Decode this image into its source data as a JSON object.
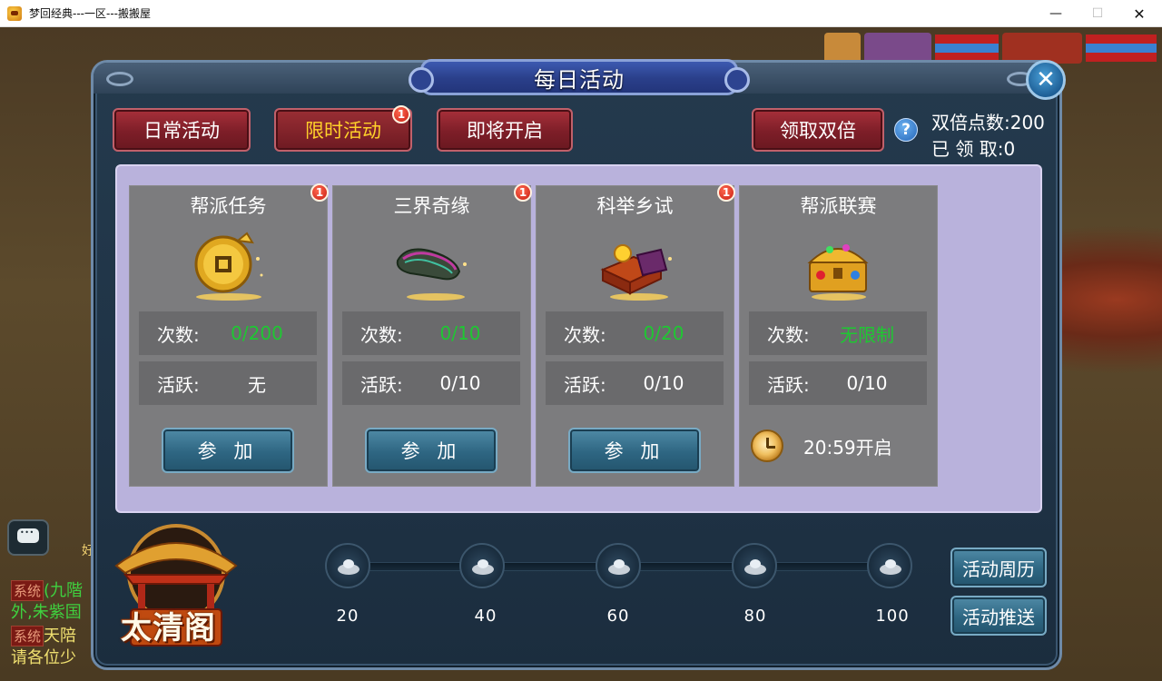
{
  "window": {
    "title": "梦回经典---一区---搬搬屋",
    "minimize": "—",
    "maximize": "☐",
    "close": "✕"
  },
  "chat": {
    "lines": [
      {
        "tag": "系统",
        "text": "(九階"
      },
      {
        "text": "外,朱紫国"
      },
      {
        "tag": "系统",
        "text": "天陪"
      },
      {
        "text": "请各位少"
      }
    ],
    "hud_partial": "好"
  },
  "dialog": {
    "title": "每日活动",
    "close_glyph": "✕",
    "tabs": [
      {
        "label": "日常活动",
        "active": false
      },
      {
        "label": "限时活动",
        "active": true,
        "badge": "1"
      },
      {
        "label": "即将开启",
        "active": false
      }
    ],
    "double_button": "领取双倍",
    "help_glyph": "?",
    "double_points": "双倍点数:200",
    "claimed": "已 领 取:0",
    "cards": [
      {
        "title": "帮派任务",
        "badge": "1",
        "icon": "gold-coin-icon",
        "count_label": "次数:",
        "count_value": "0/200",
        "active_label": "活跃:",
        "active_value": "无",
        "action": "参 加"
      },
      {
        "title": "三界奇缘",
        "badge": "1",
        "icon": "colorful-stone-icon",
        "count_label": "次数:",
        "count_value": "0/10",
        "active_label": "活跃:",
        "active_value": "0/10",
        "action": "参 加"
      },
      {
        "title": "科举乡试",
        "badge": "1",
        "icon": "exam-box-icon",
        "count_label": "次数:",
        "count_value": "0/20",
        "active_label": "活跃:",
        "active_value": "0/10",
        "action": "参 加"
      },
      {
        "title": "帮派联赛",
        "icon": "treasure-chest-icon",
        "count_label": "次数:",
        "count_value": "无限制",
        "active_label": "活跃:",
        "active_value": "0/10",
        "open_time": "20:59开启"
      }
    ],
    "milestones": [
      "20",
      "40",
      "60",
      "80",
      "100"
    ],
    "emblem_text": "太清阁",
    "side_buttons": [
      "活动周历",
      "活动推送"
    ]
  },
  "colors": {
    "green_value": "#1ec832",
    "active_tab_text": "#ffd12a",
    "panel": "#b9b2dc"
  }
}
